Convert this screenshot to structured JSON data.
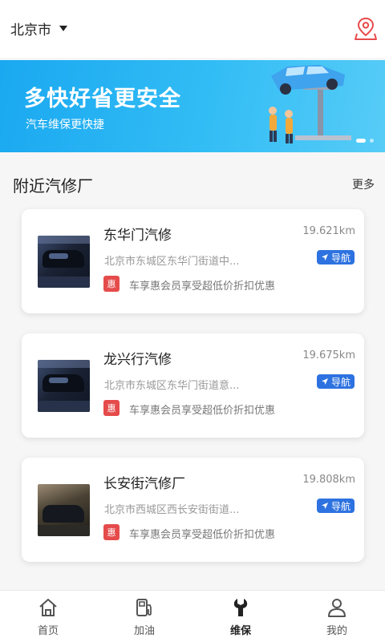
{
  "header": {
    "city": "北京市"
  },
  "banner": {
    "title": "多快好省更安全",
    "subtitle": "汽车维保更快捷"
  },
  "section": {
    "title": "附近汽修厂",
    "more": "更多"
  },
  "shops": [
    {
      "name": "东华门汽修",
      "distance": "19.621km",
      "address": "北京市东城区东华门街道中...",
      "nav_label": "导航",
      "badge": "惠",
      "promo": "车享惠会员享受超低价折扣优惠"
    },
    {
      "name": "龙兴行汽修",
      "distance": "19.675km",
      "address": "北京市东城区东华门街道意...",
      "nav_label": "导航",
      "badge": "惠",
      "promo": "车享惠会员享受超低价折扣优惠"
    },
    {
      "name": "长安街汽修厂",
      "distance": "19.808km",
      "address": "北京市西城区西长安街街道...",
      "nav_label": "导航",
      "badge": "惠",
      "promo": "车享惠会员享受超低价折扣优惠"
    }
  ],
  "tabs": [
    {
      "label": "首页",
      "icon": "home-icon"
    },
    {
      "label": "加油",
      "icon": "fuel-icon"
    },
    {
      "label": "维保",
      "icon": "wrench-icon",
      "active": true
    },
    {
      "label": "我的",
      "icon": "user-icon"
    }
  ],
  "colors": {
    "accent": "#2d72e0",
    "badge": "#e54b4b",
    "banner": "#1aa8f0",
    "location_icon": "#e84a4a"
  }
}
